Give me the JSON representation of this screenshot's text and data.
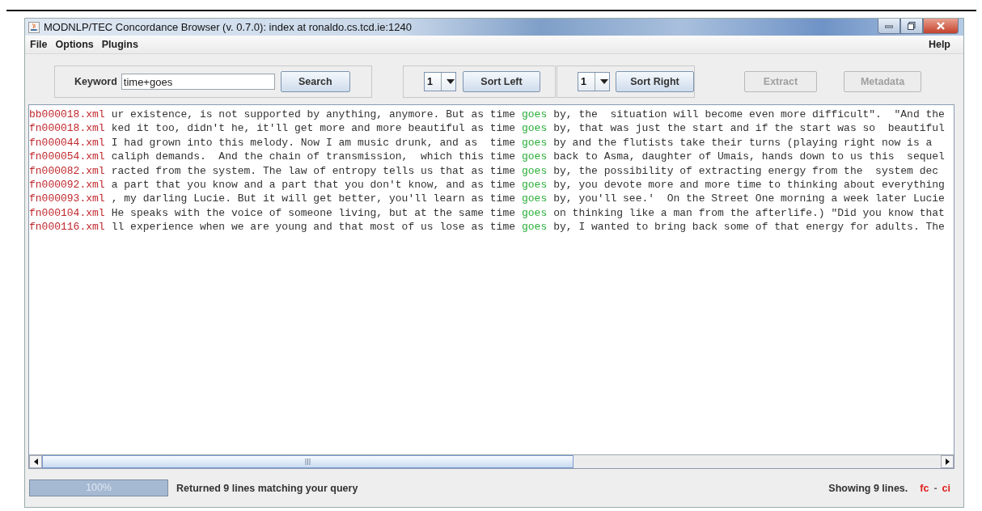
{
  "window": {
    "title": "MODNLP/TEC Concordance Browser (v. 0.7.0): index at ronaldo.cs.tcd.ie:1240"
  },
  "menu_items": [
    {
      "label": "File"
    },
    {
      "label": "Options"
    },
    {
      "label": "Plugins"
    }
  ],
  "help_menu": "Help",
  "search": {
    "label": "Keyword",
    "value": "time+goes",
    "button": "Search"
  },
  "sort_left": {
    "context": "1",
    "button": "Sort Left"
  },
  "sort_right": {
    "context": "1",
    "button": "Sort Right"
  },
  "actions": [
    {
      "label": "Extract",
      "disabled": true
    },
    {
      "label": "Metadata",
      "disabled": true
    }
  ],
  "lines": [
    {
      "file": "bb000018.xml",
      "left": "ur existence, is not supported by anything, anymore. But as time",
      "keyword": "goes",
      "right": "by, the  situation will become even more difficult\".  \"And the"
    },
    {
      "file": "fn000018.xml",
      "left": "ked it too, didn't he, it'll get more and more beautiful as time",
      "keyword": "goes",
      "right": "by, that was just the start and if the start was so  beautiful"
    },
    {
      "file": "fn000044.xml",
      "left": "I had grown into this melody. Now I am music drunk, and as  time",
      "keyword": "goes",
      "right": "by and the flutists take their turns (playing right now is a"
    },
    {
      "file": "fn000054.xml",
      "left": "caliph demands.  And the chain of transmission,  which this time",
      "keyword": "goes",
      "right": "back to Asma, daughter of Umais, hands down to us this  sequel"
    },
    {
      "file": "fn000082.xml",
      "left": "racted from the system. The law of entropy tells us that as time",
      "keyword": "goes",
      "right": "by, the possibility of extracting energy from the  system dec"
    },
    {
      "file": "fn000092.xml",
      "left": "a part that you know and a part that you don't know, and as time",
      "keyword": "goes",
      "right": "by, you devote more and more time to thinking about everything"
    },
    {
      "file": "fn000093.xml",
      "left": ", my darling Lucie. But it will get better, you'll learn as time",
      "keyword": "goes",
      "right": "by, you'll see.'  On the Street One morning a week later Lucie"
    },
    {
      "file": "fn000104.xml",
      "left": "He speaks with the voice of someone living, but at the same time",
      "keyword": "goes",
      "right": "on thinking like a man from the afterlife.) \"Did you know that"
    },
    {
      "file": "fn000116.xml",
      "left": "ll experience when we are young and that most of us lose as time",
      "keyword": "goes",
      "right": "by, I wanted to bring back some of that energy for adults. The"
    }
  ],
  "status": {
    "progress": {
      "level": 1,
      "label": "100%"
    },
    "message": "Returned 9 lines matching your query",
    "count": "Showing 9 lines.",
    "flags": [
      {
        "label": "fc"
      },
      {
        "label": "ci"
      }
    ],
    "separator": "-"
  }
}
